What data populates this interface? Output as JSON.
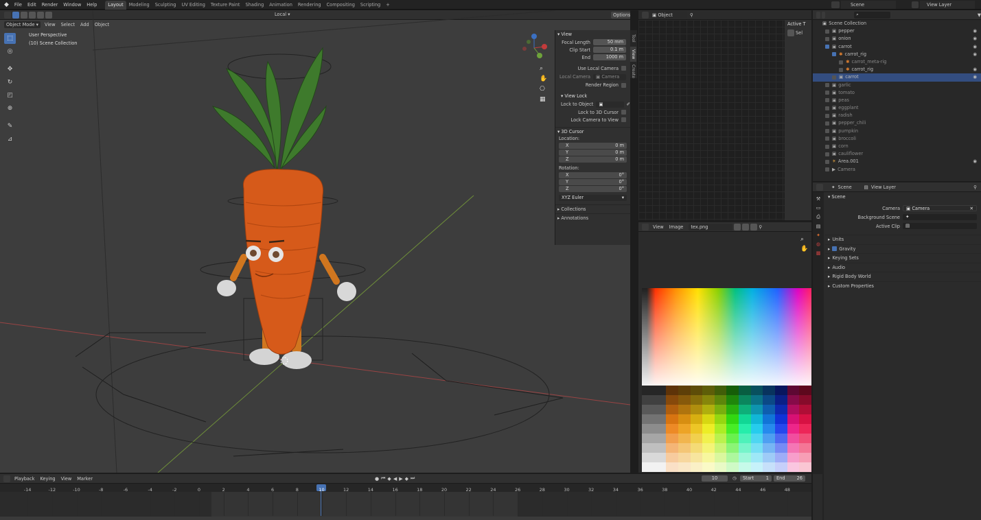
{
  "topbar": {
    "menus": [
      "File",
      "Edit",
      "Render",
      "Window",
      "Help"
    ],
    "workspaces": [
      "Layout",
      "Modeling",
      "Sculpting",
      "UV Editing",
      "Texture Paint",
      "Shading",
      "Animation",
      "Rendering",
      "Compositing",
      "Scripting"
    ],
    "active_workspace": "Layout",
    "add_tab": "+",
    "scene_label": "Scene",
    "view_layer_label": "View Layer"
  },
  "viewport": {
    "mode": "Object Mode",
    "menus": [
      "View",
      "Select",
      "Add",
      "Object"
    ],
    "orientation": "Local",
    "options": "Options",
    "perspective": "User Perspective",
    "collection": "(10) Scene Collection"
  },
  "npanel": {
    "view_header": "View",
    "focal_length_label": "Focal Length",
    "focal_length": "50 mm",
    "clip_start_label": "Clip Start",
    "clip_start": "0.1 m",
    "end_label": "End",
    "clip_end": "1000 m",
    "use_local_camera": "Use Local Camera",
    "local_camera_label": "Local Camera",
    "local_camera_value": "Camera",
    "render_region": "Render Region",
    "view_lock_header": "View Lock",
    "lock_to_object": "Lock to Object",
    "lock_to_cursor": "Lock to 3D Cursor",
    "lock_camera": "Lock Camera to View",
    "cursor_header": "3D Cursor",
    "location_label": "Location:",
    "loc": [
      {
        "axis": "X",
        "value": "0 m"
      },
      {
        "axis": "Y",
        "value": "0 m"
      },
      {
        "axis": "Z",
        "value": "0 m"
      }
    ],
    "rotation_label": "Rotation:",
    "rot": [
      {
        "axis": "X",
        "value": "0°"
      },
      {
        "axis": "Y",
        "value": "0°"
      },
      {
        "axis": "Z",
        "value": "0°"
      }
    ],
    "rotation_mode": "XYZ Euler",
    "collections": "Collections",
    "annotations": "Annotations",
    "tabs": [
      "Tool",
      "View",
      "Create"
    ]
  },
  "node_editor": {
    "object_label": "Object",
    "active_tool": "Active T",
    "select": "Sel"
  },
  "image_editor": {
    "menus": [
      "View",
      "Image"
    ],
    "image_name": "tex.png"
  },
  "outliner": {
    "root": "Scene Collection",
    "items": [
      {
        "name": "pepper",
        "indent": 0,
        "dim": false
      },
      {
        "name": "onion",
        "indent": 0,
        "dim": false
      },
      {
        "name": "carrot",
        "indent": 0,
        "dim": false,
        "checked": true
      },
      {
        "name": "carrot_rig",
        "indent": 1,
        "dim": false,
        "checked": true
      },
      {
        "name": "carrot_meta-rig",
        "indent": 2,
        "dim": true
      },
      {
        "name": "carrot_rig",
        "indent": 2,
        "dim": false
      },
      {
        "name": "carrot",
        "indent": 1,
        "dim": false,
        "selected": true
      },
      {
        "name": "garlic",
        "indent": 0,
        "dim": true
      },
      {
        "name": "tomato",
        "indent": 0,
        "dim": true
      },
      {
        "name": "peas",
        "indent": 0,
        "dim": true
      },
      {
        "name": "eggplant",
        "indent": 0,
        "dim": true
      },
      {
        "name": "radish",
        "indent": 0,
        "dim": true
      },
      {
        "name": "pepper_chili",
        "indent": 0,
        "dim": true
      },
      {
        "name": "pumpkin",
        "indent": 0,
        "dim": true
      },
      {
        "name": "broccoli",
        "indent": 0,
        "dim": true
      },
      {
        "name": "corn",
        "indent": 0,
        "dim": true
      },
      {
        "name": "cauliflower",
        "indent": 0,
        "dim": true
      },
      {
        "name": "Area.001",
        "indent": 0,
        "dim": false
      },
      {
        "name": "Camera",
        "indent": 0,
        "dim": true
      }
    ]
  },
  "properties": {
    "scene_tab": "Scene",
    "view_layer_tab": "View Layer",
    "section": "Scene",
    "camera_label": "Camera",
    "camera_value": "Camera",
    "background_scene_label": "Background Scene",
    "active_clip_label": "Active Clip",
    "subpanels": [
      "Units",
      "Gravity",
      "Keying Sets",
      "Audio",
      "Rigid Body World",
      "Custom Properties"
    ]
  },
  "timeline": {
    "menus": [
      "Playback",
      "Keying",
      "View",
      "Marker"
    ],
    "current_frame": "10",
    "start_label": "Start",
    "start": "1",
    "end_label": "End",
    "end": "26",
    "ticks": [
      "-14",
      "-12",
      "-10",
      "-8",
      "-6",
      "-4",
      "-2",
      "0",
      "2",
      "4",
      "6",
      "8",
      "10",
      "12",
      "14",
      "16",
      "18",
      "20",
      "22",
      "24",
      "26",
      "28",
      "30",
      "32",
      "34",
      "36",
      "38",
      "40",
      "42",
      "44",
      "46",
      "48"
    ]
  },
  "colors": {
    "accent": "#4772b3",
    "viewport_bg": "#3d3d3d",
    "carrot": "#d65a1a",
    "leaf": "#3e7a2c",
    "playhead": "#5680c2"
  }
}
